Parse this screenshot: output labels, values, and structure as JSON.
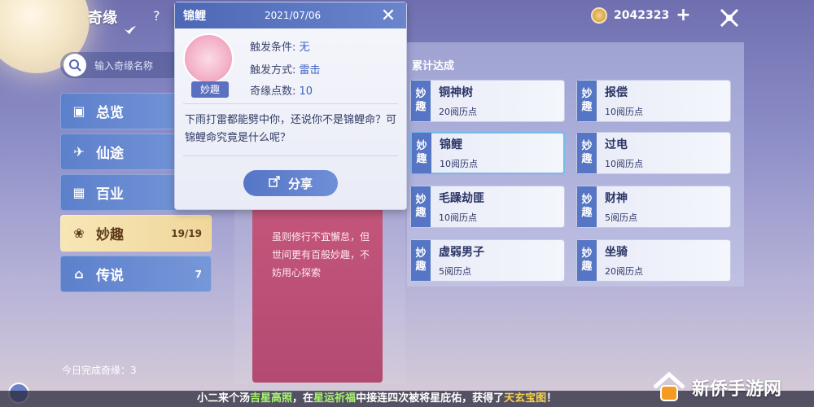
{
  "header": {
    "title": "奇缘",
    "help": "?"
  },
  "currency": {
    "amount": "2042323",
    "plus": "+"
  },
  "search": {
    "placeholder": "输入奇缘名称"
  },
  "sidebar": {
    "items": [
      {
        "label": "总览",
        "count": ""
      },
      {
        "label": "仙途",
        "count": ""
      },
      {
        "label": "百业",
        "count": ""
      },
      {
        "label": "妙趣",
        "count": "19/19"
      },
      {
        "label": "传说",
        "count": "7"
      }
    ],
    "completed": "今日完成奇缘：3"
  },
  "popup": {
    "title": "锦鲤",
    "date": "2021/07/06",
    "tag": "妙趣",
    "attrs": [
      {
        "label": "触发条件:",
        "value": "无"
      },
      {
        "label": "触发方式:",
        "value": "雷击"
      },
      {
        "label": "奇缘点数:",
        "value": "10"
      }
    ],
    "description": "下雨打雷都能劈中你，还说你不是锦鲤命？可锦鲤命究竟是什么呢？",
    "share": "分享"
  },
  "center_card": {
    "text": "虽则修行不宜懈怠，但世间更有百般妙趣，不妨用心探索"
  },
  "right": {
    "title": "累计达成",
    "achievements": [
      {
        "badge": "妙趣",
        "name": "铜神树",
        "points": "20阅历点"
      },
      {
        "badge": "妙趣",
        "name": "报偿",
        "points": "10阅历点"
      },
      {
        "badge": "妙趣",
        "name": "锦鲤",
        "points": "10阅历点"
      },
      {
        "badge": "妙趣",
        "name": "过电",
        "points": "10阅历点"
      },
      {
        "badge": "妙趣",
        "name": "毛躁劫匪",
        "points": "10阅历点"
      },
      {
        "badge": "妙趣",
        "name": "财神",
        "points": "5阅历点"
      },
      {
        "badge": "妙趣",
        "name": "虚弱男子",
        "points": "5阅历点"
      },
      {
        "badge": "妙趣",
        "name": "坐骑",
        "points": "20阅历点"
      }
    ]
  },
  "marquee": {
    "part1": "小二来个汤",
    "hl1": "吉星高照",
    "part2": "，在",
    "hl2": "星运祈福",
    "part3": "中接连四次被将星庇佑，获得了",
    "hl3": "天玄宝图",
    "part4": "！"
  },
  "watermark": {
    "text": "新侨手游网"
  }
}
